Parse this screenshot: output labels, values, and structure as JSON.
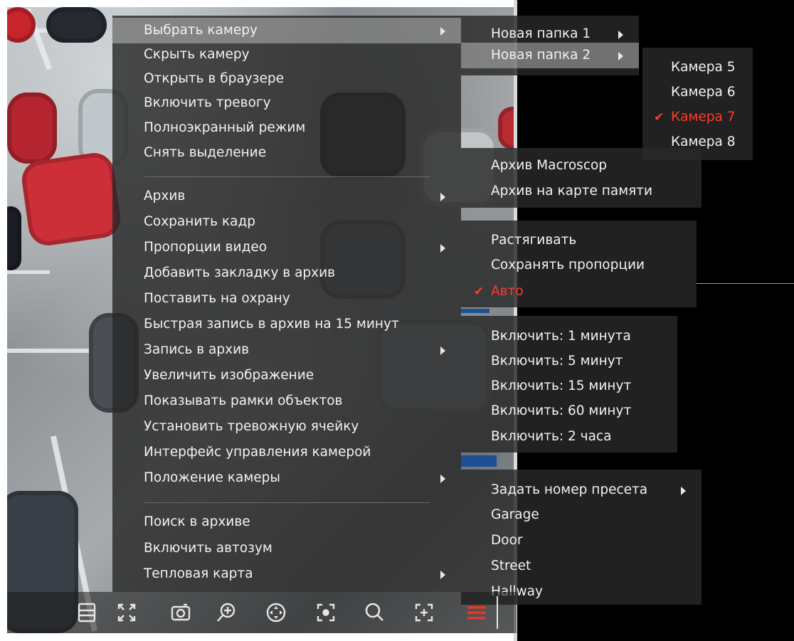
{
  "main_menu": {
    "items": [
      {
        "label": "Выбрать камеру",
        "submenu": true,
        "active": true
      },
      {
        "label": "Скрыть камеру"
      },
      {
        "label": "Открыть в браузере"
      },
      {
        "label": "Включить тревогу"
      },
      {
        "label": "Полноэкранный режим"
      },
      {
        "label": "Снять выделение"
      },
      {
        "label": "Архив",
        "submenu": true
      },
      {
        "label": "Сохранить кадр"
      },
      {
        "label": "Пропорции видео",
        "submenu": true
      },
      {
        "label": "Добавить закладку в архив"
      },
      {
        "label": "Поставить на охрану"
      },
      {
        "label": "Быстрая запись в архив на 15 минут"
      },
      {
        "label": "Запись в архив",
        "submenu": true
      },
      {
        "label": "Увеличить изображение"
      },
      {
        "label": "Показывать рамки объектов"
      },
      {
        "label": "Установить тревожную ячейку"
      },
      {
        "label": "Интерфейс управления камерой"
      },
      {
        "label": "Положение камеры",
        "submenu": true
      },
      {
        "label": "Поиск в архиве"
      },
      {
        "label": "Включить автозум"
      },
      {
        "label": "Тепловая карта",
        "submenu": true
      }
    ]
  },
  "folders_menu": {
    "items": [
      {
        "label": "Новая папка 1",
        "submenu": true
      },
      {
        "label": "Новая папка 2",
        "submenu": true,
        "active": true
      }
    ]
  },
  "cameras_menu": {
    "items": [
      {
        "label": "Камера 5"
      },
      {
        "label": "Камера 6"
      },
      {
        "label": "Камера 7",
        "checked": true
      },
      {
        "label": "Камера 8"
      }
    ]
  },
  "archive_menu": {
    "items": [
      {
        "label": "Архив Macroscop"
      },
      {
        "label": "Архив на карте памяти"
      }
    ]
  },
  "proportions_menu": {
    "items": [
      {
        "label": "Растягивать"
      },
      {
        "label": "Сохранять пропорции"
      },
      {
        "label": "Авто",
        "checked": true
      }
    ]
  },
  "record_menu": {
    "items": [
      {
        "label": "Включить: 1 минута"
      },
      {
        "label": "Включить: 5 минут"
      },
      {
        "label": "Включить: 15 минут"
      },
      {
        "label": "Включить: 60 минут"
      },
      {
        "label": "Включить: 2 часа"
      }
    ]
  },
  "position_menu": {
    "items": [
      {
        "label": "Задать номер пресета",
        "submenu": true
      },
      {
        "label": "Garage"
      },
      {
        "label": "Door"
      },
      {
        "label": "Street"
      },
      {
        "label": "Hallway"
      }
    ]
  },
  "toolbar": {
    "icons": [
      "layout-icon",
      "fullscreen-icon",
      "snapshot-icon",
      "zoom-in-icon",
      "ptz-icon",
      "focus-icon",
      "search-icon",
      "add-frame-icon",
      "menu-icon"
    ],
    "accent": "#e8352a"
  },
  "colors": {
    "checked": "#ff3a2b",
    "menu_bg": "#282828",
    "active_bg": "#8a8a8a"
  }
}
